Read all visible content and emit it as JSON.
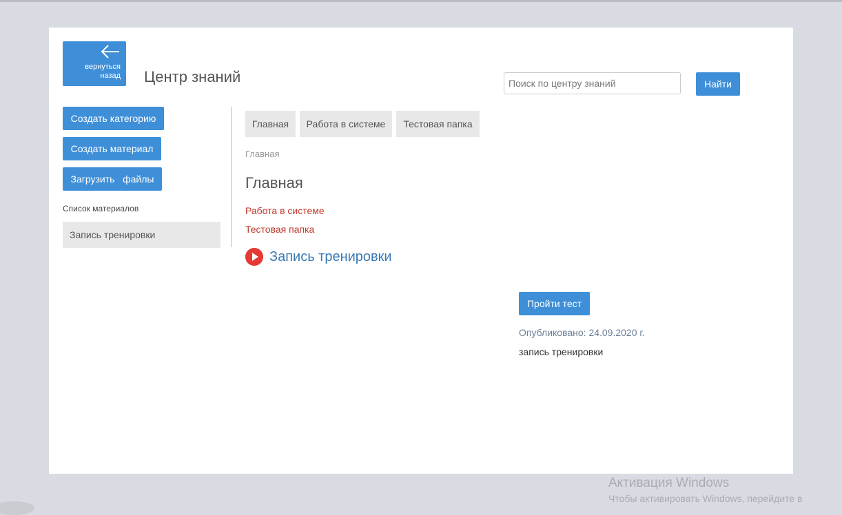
{
  "back_button": {
    "label_line1": "вернуться",
    "label_line2": "назад",
    "icon": "arrow-left-icon"
  },
  "header": {
    "title": "Центр знаний"
  },
  "search": {
    "placeholder": "Поиск по центру знаний",
    "value": "",
    "button_label": "Найти"
  },
  "sidebar": {
    "buttons": [
      "Создать категорию",
      "Создать материал",
      "Загрузить   файлы"
    ],
    "list_caption": "Список материалов",
    "items": [
      "Запись тренировки"
    ]
  },
  "tabs": [
    "Главная",
    "Работа в системе",
    "Тестовая папка"
  ],
  "breadcrumb": "Главная",
  "main": {
    "heading": "Главная",
    "categories": [
      "Работа в системе",
      "Тестовая папка"
    ],
    "video": {
      "title": "Запись тренировки",
      "icon": "play-icon"
    },
    "test_button": "Пройти тест",
    "published": "Опубликовано: 24.09.2020 г.",
    "material_text": "запись тренировки"
  },
  "watermark": {
    "title": "Активация Windows",
    "subtitle": "Чтобы активировать Windows, перейдите в"
  },
  "colors": {
    "accent": "#3f8fd8",
    "link_red": "#c0392b",
    "video_link": "#3a79b5",
    "play_red": "#e53935",
    "page_bg": "#d8dbe1"
  }
}
